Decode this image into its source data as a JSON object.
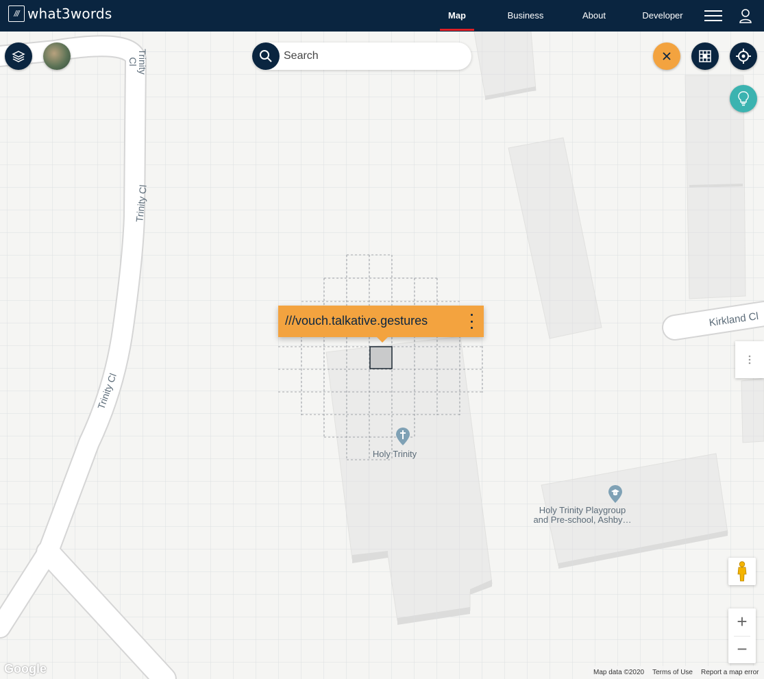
{
  "brand": {
    "mark": "///",
    "name": "what3words"
  },
  "nav": {
    "links": [
      "Map",
      "Business",
      "About",
      "Developer"
    ]
  },
  "search": {
    "placeholder": "Search"
  },
  "address": {
    "text": "///vouch.talkative.gestures"
  },
  "streets": [
    "Trinity Cl",
    "Trinity Cl",
    "Trinity Cl",
    "Kirkland Cl"
  ],
  "places": [
    {
      "name": "Holy Trinity"
    },
    {
      "name": "Holy Trinity Playgroup",
      "name2": "and Pre-school, Ashby…"
    }
  ],
  "footer": {
    "google": "Google",
    "map_data": "Map data ©2020",
    "terms": "Terms of Use",
    "report": "Report a map error"
  },
  "zoom": {
    "in": "+",
    "out": "−"
  },
  "colors": {
    "navy": "#0a2540",
    "orange": "#f3a33f",
    "teal": "#3bb3b0",
    "active_underline": "#e11f26"
  },
  "icons": [
    "layers-icon",
    "satellite-thumbnail",
    "search-icon",
    "close-icon",
    "grid-icon",
    "locate-icon",
    "lightbulb-icon",
    "menu-icon",
    "user-icon",
    "pegman-icon",
    "cross-pin-icon",
    "school-pin-icon"
  ]
}
